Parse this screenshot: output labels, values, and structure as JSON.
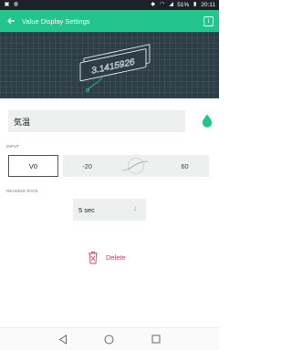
{
  "status_bar": {
    "battery_percent": "51%",
    "time": "20:11"
  },
  "app_bar": {
    "title": "Value Display Settings",
    "info_label": "i"
  },
  "hero": {
    "display_value": "3.1415926"
  },
  "name_field": {
    "value": "気温"
  },
  "colors": {
    "accent": "#23c48e",
    "delete": "#d3435c",
    "status_bar": "#1a2327",
    "hero_bg": "#2d3e46"
  },
  "input": {
    "label": "INPUT",
    "pin": "V0",
    "min": "-20",
    "max": "60"
  },
  "reading_rate": {
    "label": "READING RATE",
    "value": "5 sec"
  },
  "delete_label": "Delete",
  "icons": {
    "back": "arrow-left-icon",
    "info": "info-icon",
    "color": "droplet-icon",
    "mapping": "curve-mapping-icon",
    "dropdown": "arrow-down-icon",
    "delete": "trash-icon",
    "nav_back": "triangle-back-icon",
    "nav_home": "circle-home-icon",
    "nav_recent": "square-recent-icon"
  }
}
